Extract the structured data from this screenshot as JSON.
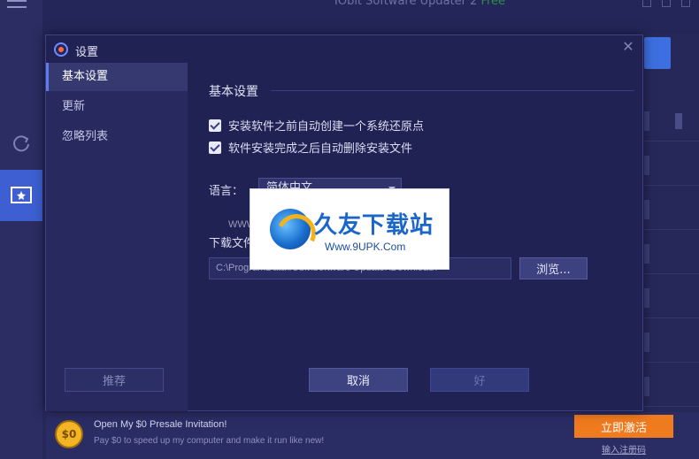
{
  "app": {
    "window_title": "IObit Software Updater 2",
    "window_title_badge": "Free"
  },
  "promo": {
    "icon_text": "$0",
    "title": "Open My $0 Presale Invitation!",
    "subtitle": "Pay $0 to speed up my computer and make it run like new!",
    "activate_button": "立即激活",
    "register_link": "输入注册码"
  },
  "dialog": {
    "title": "设置",
    "close_glyph": "✕",
    "sidebar": {
      "items": [
        {
          "label": "基本设置",
          "active": true
        },
        {
          "label": "更新",
          "active": false
        },
        {
          "label": "忽略列表",
          "active": false
        }
      ],
      "recommend_button": "推荐"
    },
    "main": {
      "section_title": "基本设置",
      "checkboxes": [
        {
          "label": "安装软件之前自动创建一个系统还原点",
          "checked": true
        },
        {
          "label": "软件安装完成之后自动删除安装文件",
          "checked": true
        }
      ],
      "language": {
        "label": "语言：",
        "value": "简体中文"
      },
      "download": {
        "label": "下载文件夹：",
        "path": "C:\\ProgramData\\IObit\\Software Updater\\Download\\",
        "browse_button": "浏览..."
      },
      "cancel_button": "取消",
      "ok_button": "好"
    }
  },
  "watermark": {
    "site_name": "久友下载站",
    "url": "Www.9UPK.Com",
    "ghost_text": "WWW.9UPK.COM"
  }
}
